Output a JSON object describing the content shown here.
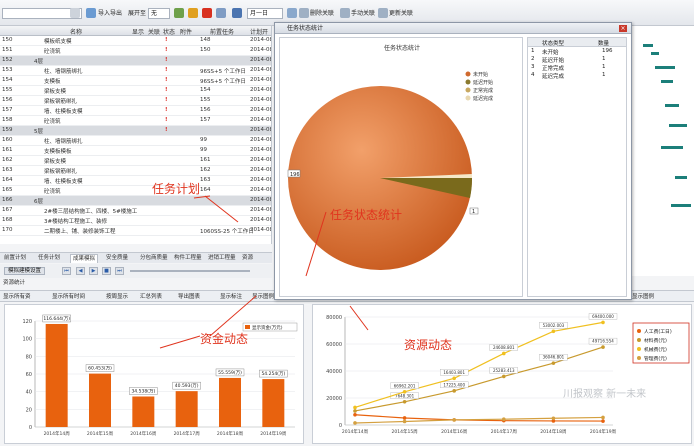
{
  "toolbar": {
    "import_export": "导入导出",
    "expand_label": "展开至",
    "expand_value": "无",
    "zoom_value": "月一日",
    "btn_a": "删除关联",
    "btn_b": "手动关联",
    "btn_c": "更新关联"
  },
  "grid": {
    "headers": {
      "name": "名称",
      "show": "显示",
      "rel": "关联",
      "status": "状态",
      "attach": "附件",
      "plan": "前置任务",
      "start": "计划开"
    },
    "rows": [
      {
        "id": "150",
        "name": "模板纸支模",
        "attach": "148",
        "start": "2014-08-",
        "excl": true
      },
      {
        "id": "151",
        "name": "砼浇筑",
        "attach": "150",
        "start": "2014-08-",
        "excl": true
      },
      {
        "id": "152",
        "name": "4层",
        "attach": "",
        "start": "2014-08-",
        "sel": true,
        "excl": true
      },
      {
        "id": "153",
        "name": "柱、墙钢筋绑扎",
        "attach": "96SS+5 个工作日",
        "start": "2014-08-",
        "excl": true
      },
      {
        "id": "154",
        "name": "支模板",
        "attach": "96SS+5 个工作日",
        "start": "2014-08-",
        "excl": true
      },
      {
        "id": "155",
        "name": "梁板支模",
        "attach": "154",
        "start": "2014-08-",
        "excl": true
      },
      {
        "id": "156",
        "name": "梁板钢筋绑扎",
        "attach": "155",
        "start": "2014-08-",
        "excl": true
      },
      {
        "id": "157",
        "name": "墙、柱模板支模",
        "attach": "156",
        "start": "2014-08-",
        "excl": true
      },
      {
        "id": "158",
        "name": "砼浇筑",
        "attach": "157",
        "start": "2014-08-",
        "excl": true
      },
      {
        "id": "159",
        "name": "5层",
        "attach": "",
        "start": "2014-08-",
        "sel": true,
        "excl": true
      },
      {
        "id": "160",
        "name": "柱、墙钢筋绑扎",
        "attach": "99",
        "start": "2014-08-",
        "excl": false
      },
      {
        "id": "161",
        "name": "支模板模板",
        "attach": "99",
        "start": "2014-08-",
        "excl": false
      },
      {
        "id": "162",
        "name": "梁板支模",
        "attach": "161",
        "start": "2014-08-",
        "excl": false
      },
      {
        "id": "163",
        "name": "梁板钢筋绑扎",
        "attach": "162",
        "start": "2014-08-",
        "excl": false
      },
      {
        "id": "164",
        "name": "墙、柱模板支模",
        "attach": "163",
        "start": "2014-08-",
        "excl": false
      },
      {
        "id": "165",
        "name": "砼浇筑",
        "attach": "164",
        "start": "2014-08-",
        "excl": false
      },
      {
        "id": "166",
        "name": "6层",
        "attach": "",
        "start": "2014-08-",
        "sel": true,
        "excl": false
      },
      {
        "id": "167",
        "name": "2#楼三层结构施工、四楼、5#楼施工",
        "attach": "",
        "start": "2014-08-",
        "excl": false
      },
      {
        "id": "168",
        "name": "3#楼结构工程施工、装修",
        "attach": "",
        "start": "2014-08-",
        "excl": false
      },
      {
        "id": "170",
        "name": "二期楼上、铺、装修装饰工程",
        "attach": "1060SS-25 个工作日",
        "start": "2014-08-",
        "excl": false
      }
    ]
  },
  "tabs": [
    "前置计划",
    "任务计划",
    "成果模拟",
    "安全质量",
    "分包商质量",
    "构件工程量",
    "进销工程量",
    "资源"
  ],
  "player": {
    "label": "模拟建模设置",
    "status": "资源统计"
  },
  "optbar": {
    "opt1": "显示所有资",
    "opt2": "显示所有时间",
    "opt3": "按周显示",
    "opt4": "汇总列表",
    "opt5": "导出图表",
    "opt6": "显示标注",
    "opt7": "显示图例",
    "opt8": "显示图例"
  },
  "popup": {
    "title": "任务状态统计",
    "chart_title": "任务状态统计",
    "legend": [
      "未开始",
      "延迟开始",
      "正常完成",
      "延迟完成"
    ],
    "table_headers": [
      "状态类型",
      "数量"
    ],
    "table_rows": [
      {
        "idx": "1",
        "type": "未开始",
        "count": "196"
      },
      {
        "idx": "2",
        "type": "延迟开始",
        "count": "1"
      },
      {
        "idx": "3",
        "type": "正常完成",
        "count": "1"
      },
      {
        "idx": "4",
        "type": "延迟完成",
        "count": "1"
      }
    ],
    "pie_label_main": "196",
    "pie_label_small": "1"
  },
  "annotations": {
    "task_plan": "任务计划",
    "task_status": "任务状态统计",
    "funds": "资金动态",
    "resource": "资源动态"
  },
  "chart_data": [
    {
      "type": "bar",
      "categories": [
        "2014年14周",
        "2014年15周",
        "2014年16周",
        "2014年17周",
        "2014年18周",
        "2014年19周"
      ],
      "values": [
        116.644,
        60.453,
        34.538,
        40.593,
        55.559,
        54.254
      ],
      "value_labels": [
        "116.644(万)",
        "60.453(万)",
        "34.538(万)",
        "40.593(万)",
        "55.559(万)",
        "54.254(万)"
      ],
      "legend": "显示资金(万元)",
      "ylim": [
        0,
        120
      ],
      "yticks": [
        0,
        20,
        40,
        60,
        80,
        100,
        120
      ],
      "colors": {
        "bar": "#e8620e"
      }
    },
    {
      "type": "line",
      "categories": [
        "2014年14周",
        "2014年15周",
        "2014年16周",
        "2014年17周",
        "2014年18周",
        "2014年19周"
      ],
      "ylim": [
        0,
        80000
      ],
      "yticks": [
        0,
        20000,
        40000,
        60000,
        80000
      ],
      "series": [
        {
          "name": "人工费(工日)",
          "values": [
            7600,
            5200,
            3800,
            3200,
            3000,
            2900
          ],
          "color": "#e8620e"
        },
        {
          "name": "材料费(元)",
          "values": [
            10400,
            17200,
            25300,
            36000,
            45800,
            57700
          ],
          "color": "#c89a2e"
        },
        {
          "name": "机械费(元)",
          "values": [
            13000,
            24600,
            34600,
            53000,
            69400,
            76000
          ],
          "color": "#f0c020"
        },
        {
          "name": "管理费(元)",
          "values": [
            1500,
            2600,
            3800,
            4300,
            5000,
            5600
          ],
          "color": "#d4a040"
        }
      ],
      "point_labels": [
        "7648.301",
        "17225.400",
        "25283.413",
        "36046.801",
        "49716.554",
        "66962.201",
        "16403.801",
        "24608.801",
        "53002.003",
        "69400.000",
        "76000.000"
      ],
      "watermark": "川报观察 新一未来"
    }
  ]
}
